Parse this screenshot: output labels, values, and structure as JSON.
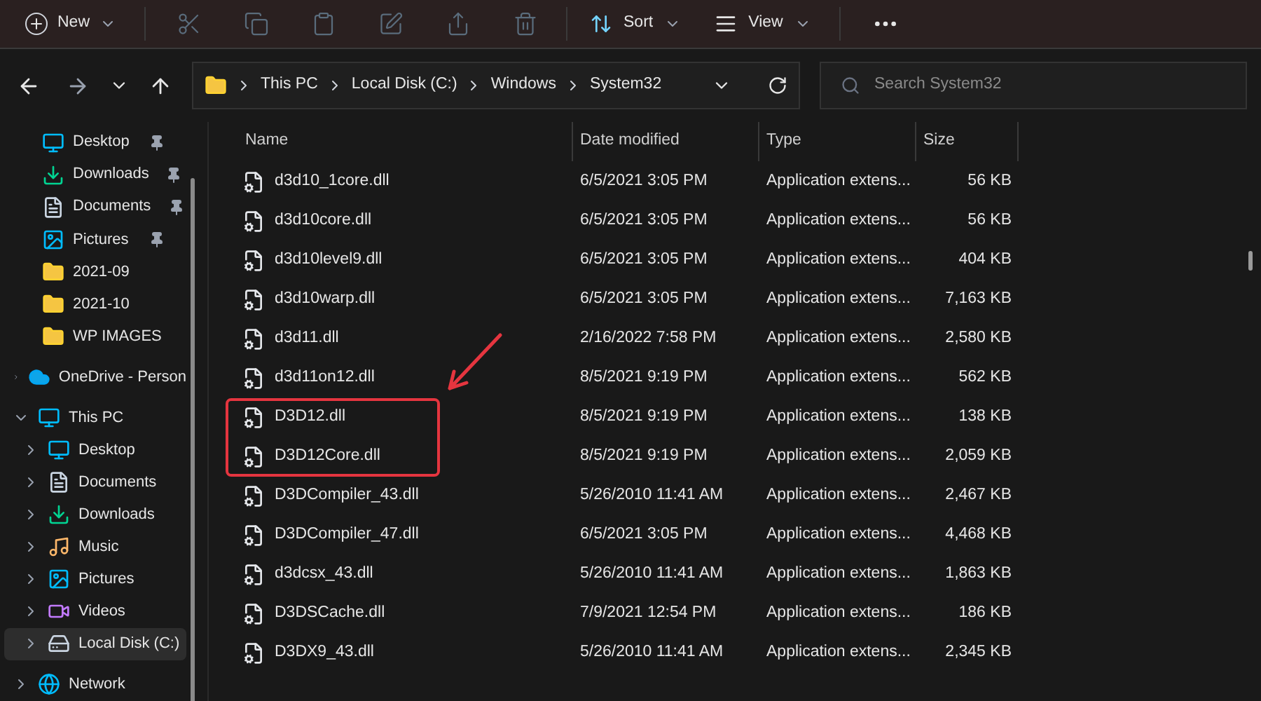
{
  "toolbar": {
    "new_label": "New",
    "sort_label": "Sort",
    "view_label": "View"
  },
  "address": {
    "crumbs": [
      "This PC",
      "Local Disk (C:)",
      "Windows",
      "System32"
    ]
  },
  "search": {
    "placeholder": "Search System32"
  },
  "sidebar": {
    "quick_access": [
      {
        "label": "Desktop",
        "kind": "desktop",
        "pinned": true
      },
      {
        "label": "Downloads",
        "kind": "downloads",
        "pinned": true
      },
      {
        "label": "Documents",
        "kind": "documents",
        "pinned": true
      },
      {
        "label": "Pictures",
        "kind": "pictures",
        "pinned": true
      },
      {
        "label": "2021-09",
        "kind": "folder",
        "pinned": false
      },
      {
        "label": "2021-10",
        "kind": "folder",
        "pinned": false
      },
      {
        "label": "WP IMAGES",
        "kind": "folder",
        "pinned": false
      }
    ],
    "tree": [
      {
        "label": "OneDrive - Person",
        "kind": "cloud",
        "expanded": false,
        "selected": false
      },
      {
        "label": "This PC",
        "kind": "pc",
        "expanded": true,
        "selected": false,
        "children": [
          {
            "label": "Desktop",
            "kind": "desktop",
            "expanded": false,
            "selected": false
          },
          {
            "label": "Documents",
            "kind": "documents",
            "expanded": false,
            "selected": false
          },
          {
            "label": "Downloads",
            "kind": "downloads",
            "expanded": false,
            "selected": false
          },
          {
            "label": "Music",
            "kind": "music",
            "expanded": false,
            "selected": false
          },
          {
            "label": "Pictures",
            "kind": "pictures",
            "expanded": false,
            "selected": false
          },
          {
            "label": "Videos",
            "kind": "videos",
            "expanded": false,
            "selected": false
          },
          {
            "label": "Local Disk (C:)",
            "kind": "drive",
            "expanded": false,
            "selected": true
          }
        ]
      },
      {
        "label": "Network",
        "kind": "network",
        "expanded": false,
        "selected": false
      }
    ]
  },
  "table": {
    "columns": [
      "Name",
      "Date modified",
      "Type",
      "Size"
    ],
    "rows": [
      {
        "name": "d3d10_1core.dll",
        "date": "6/5/2021 3:05 PM",
        "type": "Application extens...",
        "size": "56 KB",
        "highlighted": false
      },
      {
        "name": "d3d10core.dll",
        "date": "6/5/2021 3:05 PM",
        "type": "Application extens...",
        "size": "56 KB",
        "highlighted": false
      },
      {
        "name": "d3d10level9.dll",
        "date": "6/5/2021 3:05 PM",
        "type": "Application extens...",
        "size": "404 KB",
        "highlighted": false
      },
      {
        "name": "d3d10warp.dll",
        "date": "6/5/2021 3:05 PM",
        "type": "Application extens...",
        "size": "7,163 KB",
        "highlighted": false
      },
      {
        "name": "d3d11.dll",
        "date": "2/16/2022 7:58 PM",
        "type": "Application extens...",
        "size": "2,580 KB",
        "highlighted": false
      },
      {
        "name": "d3d11on12.dll",
        "date": "8/5/2021 9:19 PM",
        "type": "Application extens...",
        "size": "562 KB",
        "highlighted": false
      },
      {
        "name": "D3D12.dll",
        "date": "8/5/2021 9:19 PM",
        "type": "Application extens...",
        "size": "138 KB",
        "highlighted": true
      },
      {
        "name": "D3D12Core.dll",
        "date": "8/5/2021 9:19 PM",
        "type": "Application extens...",
        "size": "2,059 KB",
        "highlighted": true
      },
      {
        "name": "D3DCompiler_43.dll",
        "date": "5/26/2010 11:41 AM",
        "type": "Application extens...",
        "size": "2,467 KB",
        "highlighted": false
      },
      {
        "name": "D3DCompiler_47.dll",
        "date": "6/5/2021 3:05 PM",
        "type": "Application extens...",
        "size": "4,468 KB",
        "highlighted": false
      },
      {
        "name": "d3dcsx_43.dll",
        "date": "5/26/2010 11:41 AM",
        "type": "Application extens...",
        "size": "1,863 KB",
        "highlighted": false
      },
      {
        "name": "D3DSCache.dll",
        "date": "7/9/2021 12:54 PM",
        "type": "Application extens...",
        "size": "186 KB",
        "highlighted": false
      },
      {
        "name": "D3DX9_43.dll",
        "date": "5/26/2010 11:41 AM",
        "type": "Application extens...",
        "size": "2,345 KB",
        "highlighted": false
      }
    ]
  }
}
